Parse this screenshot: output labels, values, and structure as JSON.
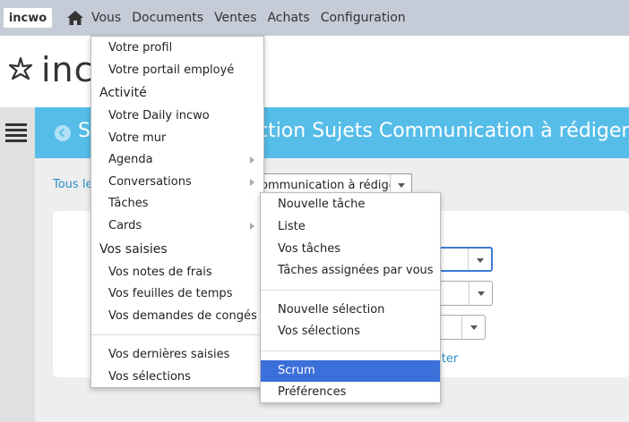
{
  "app": {
    "brand": "incwo",
    "logo_text": "inc"
  },
  "nav": {
    "items": [
      "Vous",
      "Documents",
      "Ventes",
      "Achats",
      "Configuration"
    ]
  },
  "page": {
    "title": "Sélection Sujets Communication à rédiger",
    "title_visible": "ction Sujets Communication à rédiger",
    "breadcrumb_link": "Tous le",
    "breadcrumb_select_value": "ommunication à rédiger",
    "reset_link": "ster"
  },
  "menu_vous": {
    "items": [
      {
        "label": "Votre profil",
        "type": "item"
      },
      {
        "label": "Votre portail employé",
        "type": "item"
      },
      {
        "label": "Activité",
        "type": "header"
      },
      {
        "label": "Votre Daily incwo",
        "type": "item"
      },
      {
        "label": "Votre mur",
        "type": "item"
      },
      {
        "label": "Agenda",
        "type": "item",
        "submenu": true
      },
      {
        "label": "Conversations",
        "type": "item",
        "submenu": true
      },
      {
        "label": "Tâches",
        "type": "item"
      },
      {
        "label": "Cards",
        "type": "item",
        "submenu": true
      },
      {
        "label": "Vos saisies",
        "type": "header"
      },
      {
        "label": "Vos notes de frais",
        "type": "item"
      },
      {
        "label": "Vos feuilles de temps",
        "type": "item"
      },
      {
        "label": "Vos demandes de congés",
        "type": "item"
      },
      {
        "label": "Vos dernières saisies",
        "type": "item"
      },
      {
        "label": "Vos sélections",
        "type": "item"
      }
    ]
  },
  "menu_taches": {
    "items": [
      {
        "label": "Nouvelle tâche"
      },
      {
        "label": "Liste"
      },
      {
        "label": "Vos tâches"
      },
      {
        "label": "Tâches assignées par vous"
      },
      {
        "label": "Nouvelle sélection"
      },
      {
        "label": "Vos sélections"
      },
      {
        "label": "Scrum",
        "active": true
      },
      {
        "label": "Préférences"
      }
    ]
  },
  "colors": {
    "topbar": "#c5ccd8",
    "title_band": "#56bde9",
    "link": "#2a8ec9",
    "menu_active": "#3b6fd9"
  },
  "icons": [
    "home-icon",
    "logo-star-icon",
    "hamburger-icon",
    "back-icon",
    "chevron-down-icon",
    "submenu-arrow-icon"
  ]
}
